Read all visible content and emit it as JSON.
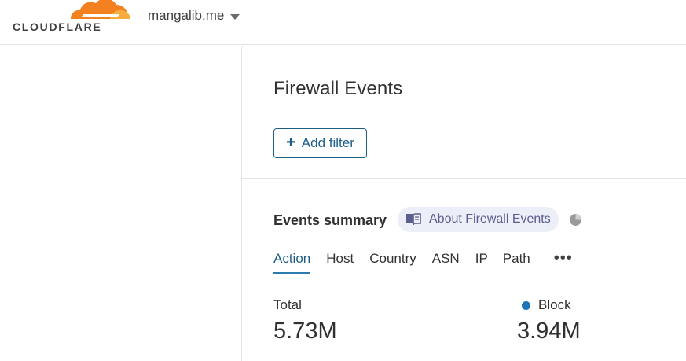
{
  "header": {
    "logo_text": "CLOUDFLARE",
    "zone_name": "mangalib.me",
    "brand_colors": {
      "orange": "#f48120",
      "light_orange": "#faad3f"
    }
  },
  "main": {
    "title": "Firewall Events",
    "add_filter_label": "Add filter",
    "summary": {
      "title": "Events summary",
      "about_label": "About Firewall Events",
      "tabs": [
        {
          "label": "Action",
          "active": true
        },
        {
          "label": "Host",
          "active": false
        },
        {
          "label": "Country",
          "active": false
        },
        {
          "label": "ASN",
          "active": false
        },
        {
          "label": "IP",
          "active": false
        },
        {
          "label": "Path",
          "active": false
        }
      ],
      "more_label": "•••",
      "stats": {
        "total_label": "Total",
        "total_value": "5.73M",
        "block_label": "Block",
        "block_value": "3.94M",
        "block_color": "#1d74b6"
      }
    }
  }
}
